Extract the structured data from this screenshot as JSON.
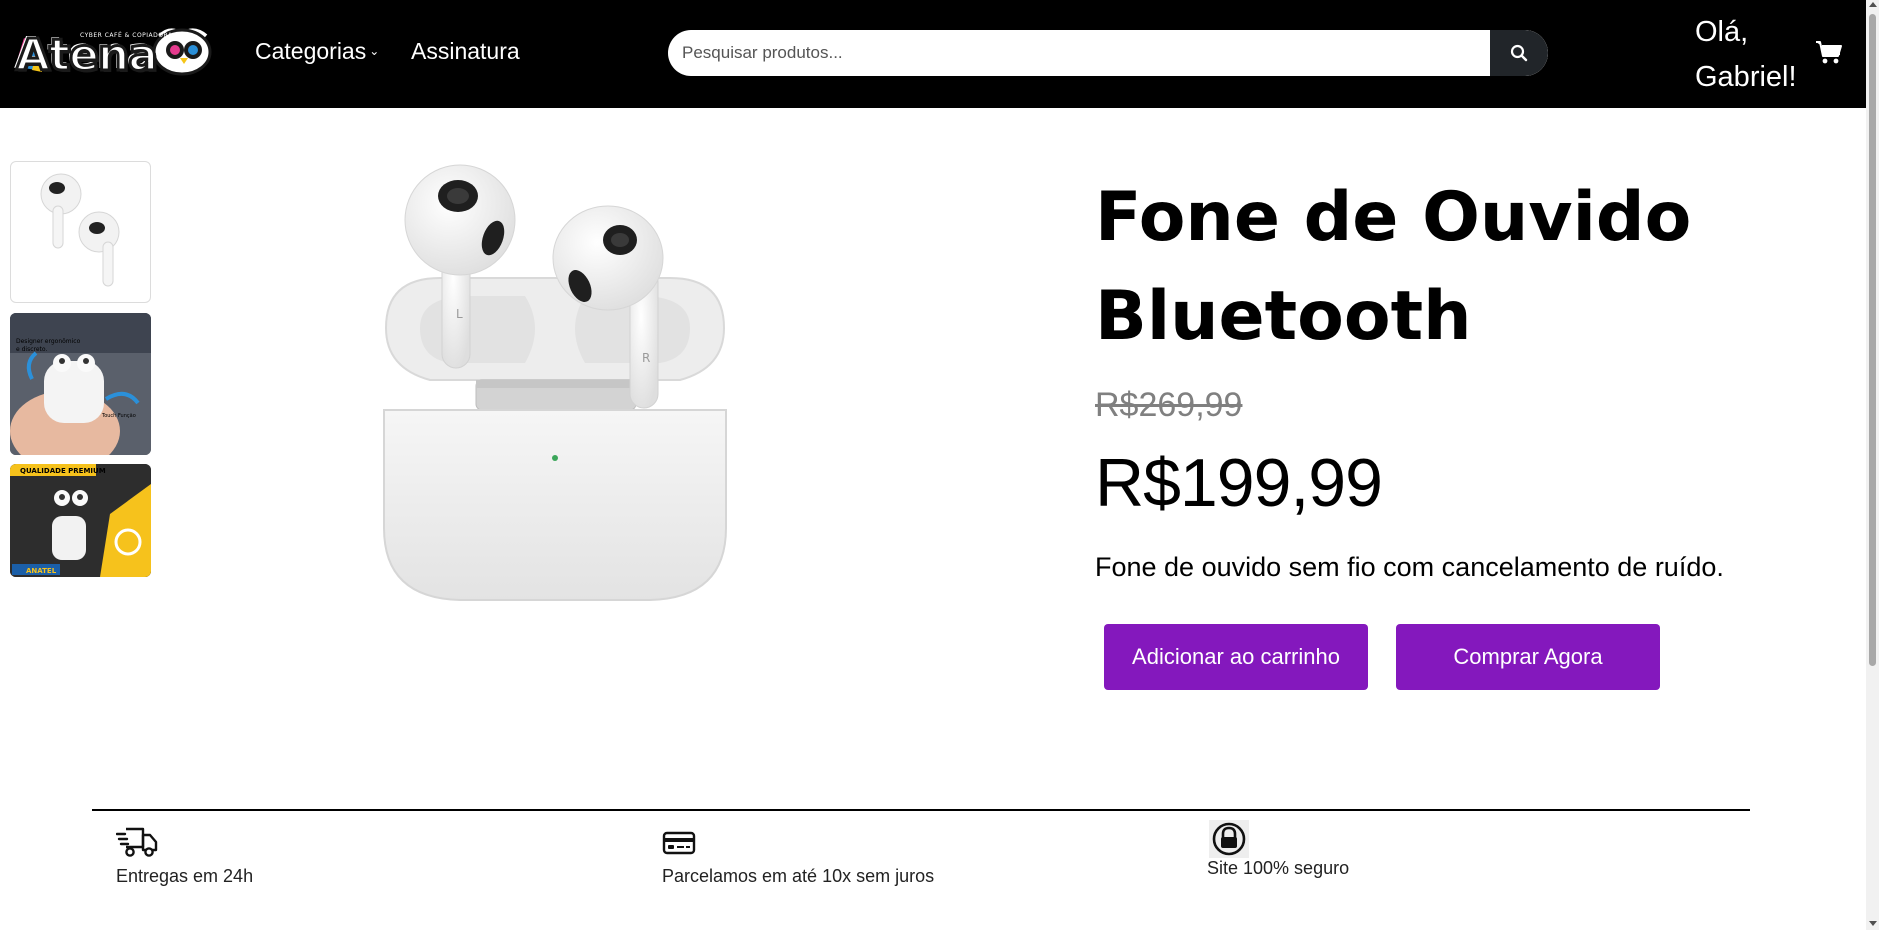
{
  "header": {
    "logo": {
      "word": "Atena",
      "tagline": "CYBER CAFÉ & COPIADORA"
    },
    "nav": {
      "categorias": "Categorias",
      "assinatura": "Assinatura"
    },
    "search": {
      "placeholder": "Pesquisar produtos...",
      "value": ""
    },
    "greeting": "Olá, Gabriel!"
  },
  "gallery": {
    "thumbnails": [
      {
        "name": "earbuds-front"
      },
      {
        "name": "earbuds-in-hand"
      },
      {
        "name": "qualidade-premium"
      }
    ],
    "thumb_texts": {
      "t2_line1": "Designer ergonômico",
      "t2_line2": "e discreto.",
      "t2_touch": "Touch Função",
      "t3_badge": "QUALIDADE PREMIUM",
      "t3_anatel": "ANATEL"
    }
  },
  "product": {
    "title": "Fone de Ouvido Bluetooth",
    "old_price": "R$269,99",
    "price": "R$199,99",
    "description": "Fone de ouvido sem fio com cancelamento de ruído.",
    "add_to_cart_label": "Adicionar ao carrinho",
    "buy_now_label": "Comprar Agora"
  },
  "features": [
    {
      "icon": "delivery-truck-icon",
      "label": "Entregas em 24h"
    },
    {
      "icon": "credit-card-icon",
      "label": "Parcelamos em até 10x sem juros"
    },
    {
      "icon": "lock-icon",
      "label": "Site 100% seguro"
    }
  ],
  "colors": {
    "header_bg": "#000000",
    "button_purple": "#8418bd",
    "search_button": "#212529",
    "old_price_gray": "#808080"
  }
}
